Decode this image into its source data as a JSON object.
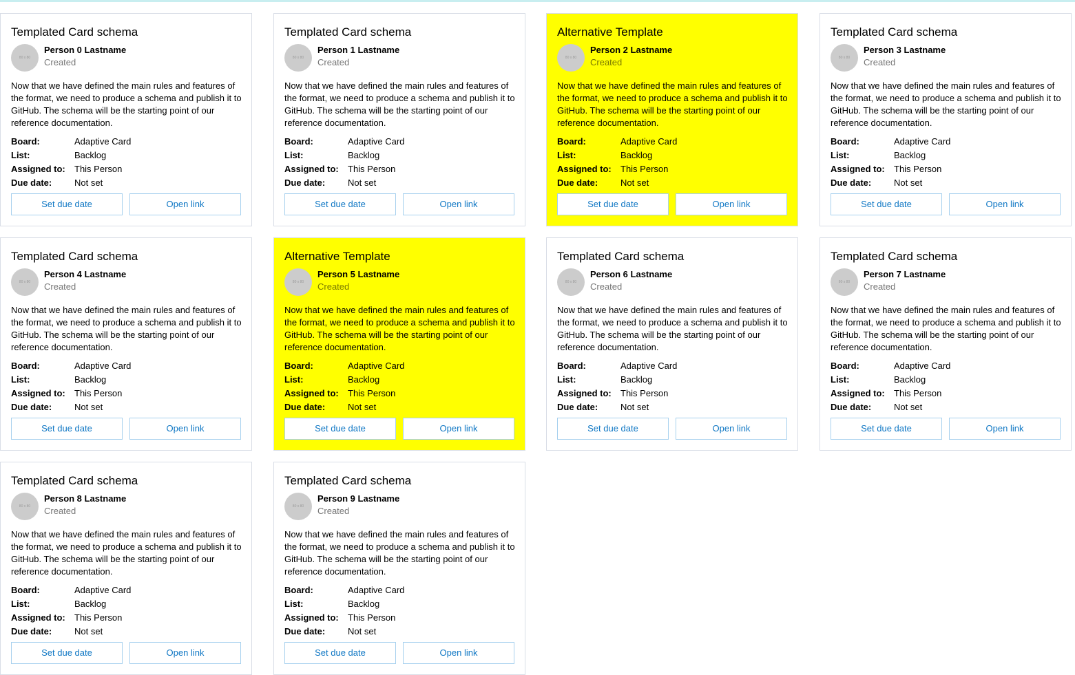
{
  "cards": [
    {
      "title": "Templated Card schema",
      "person": "Person 0 Lastname",
      "status": "Created",
      "variant": "default"
    },
    {
      "title": "Templated Card schema",
      "person": "Person 1 Lastname",
      "status": "Created",
      "variant": "default"
    },
    {
      "title": "Alternative Template",
      "person": "Person 2 Lastname",
      "status": "Created",
      "variant": "alternative"
    },
    {
      "title": "Templated Card schema",
      "person": "Person 3 Lastname",
      "status": "Created",
      "variant": "default"
    },
    {
      "title": "Templated Card schema",
      "person": "Person 4 Lastname",
      "status": "Created",
      "variant": "default"
    },
    {
      "title": "Alternative Template",
      "person": "Person 5 Lastname",
      "status": "Created",
      "variant": "alternative"
    },
    {
      "title": "Templated Card schema",
      "person": "Person 6 Lastname",
      "status": "Created",
      "variant": "default"
    },
    {
      "title": "Templated Card schema",
      "person": "Person 7 Lastname",
      "status": "Created",
      "variant": "default"
    },
    {
      "title": "Templated Card schema",
      "person": "Person 8 Lastname",
      "status": "Created",
      "variant": "default"
    },
    {
      "title": "Templated Card schema",
      "person": "Person 9 Lastname",
      "status": "Created",
      "variant": "default"
    }
  ],
  "shared": {
    "avatar_placeholder": "80 x 80",
    "description": "Now that we have defined the main rules and features of the format, we need to produce a schema and publish it to GitHub. The schema will be the starting point of our reference documentation.",
    "facts": [
      {
        "key": "Board:",
        "value": "Adaptive Card"
      },
      {
        "key": "List:",
        "value": "Backlog"
      },
      {
        "key": "Assigned to:",
        "value": "This Person"
      },
      {
        "key": "Due date:",
        "value": "Not set"
      }
    ],
    "actions": {
      "set_due_date": "Set due date",
      "open_link": "Open link"
    }
  },
  "colors": {
    "alternative_background": "#ffff00",
    "button_text": "#0f77c4",
    "button_border": "#a6d0ee",
    "card_border": "#d8dde6",
    "avatar": "#cccccc"
  },
  "icons": {
    "avatar": "profile-placeholder-icon"
  }
}
